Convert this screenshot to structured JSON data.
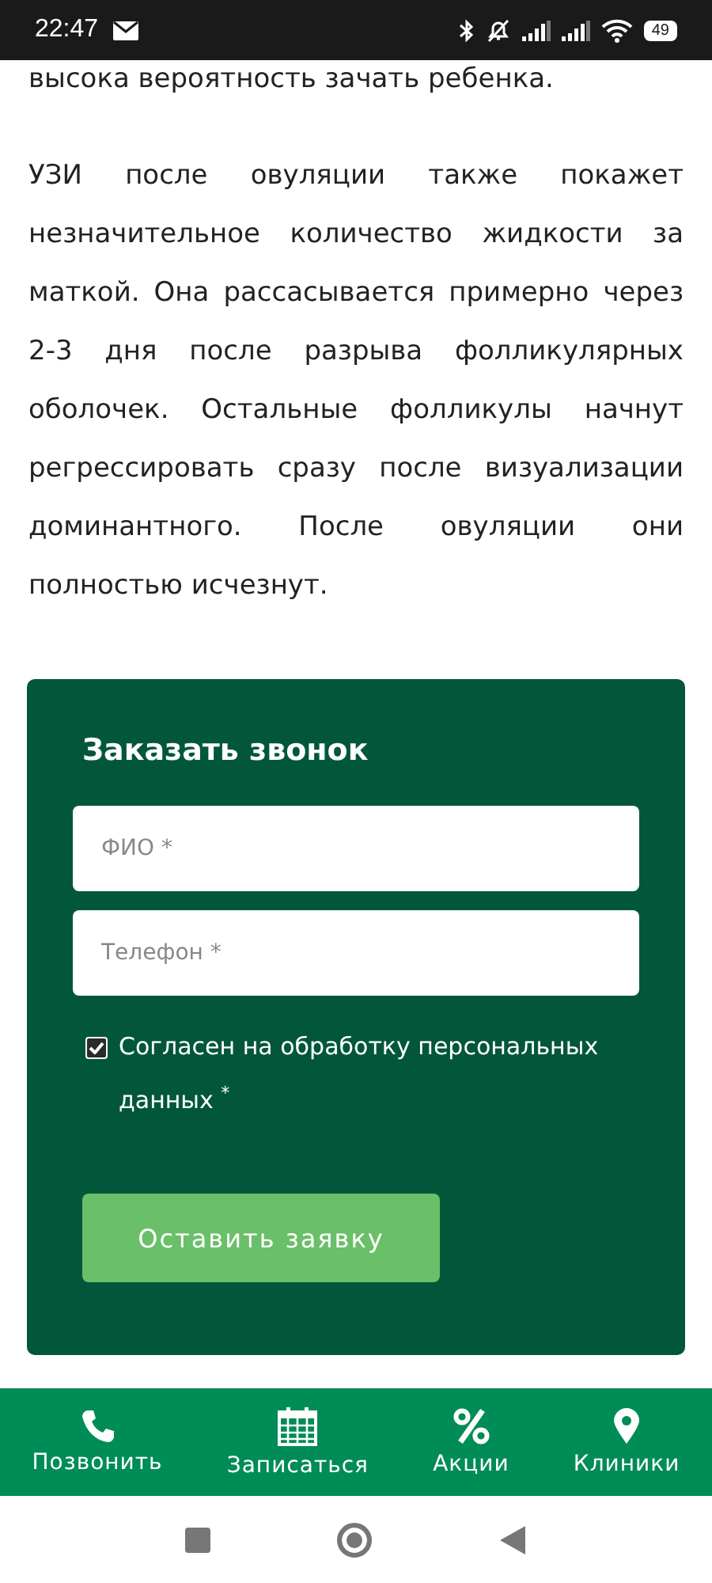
{
  "status_bar": {
    "time": "22:47",
    "battery": "49"
  },
  "article": {
    "paragraphs": [
      "высока вероятность зачать ребенка.",
      "УЗИ после овуляции также покажет незначительное количество жидкости за маткой. Она рассасывается примерно через 2-3 дня после разрыва фолликулярных оболочек. Остальные фолликулы начнут регрессировать сразу после визуализации доминантного. После овуляции они полностью исчезнут."
    ]
  },
  "callback_form": {
    "title": "Заказать звонок",
    "fields": [
      {
        "placeholder": "ФИО *"
      },
      {
        "placeholder": "Телефон *"
      }
    ],
    "consent": {
      "label": "Согласен на обработку персональных данных",
      "required_mark": "*",
      "checked": true
    },
    "submit": "Оставить заявку"
  },
  "bottom_nav": [
    {
      "kind": "phone",
      "label": "Позвонить"
    },
    {
      "kind": "calendar",
      "label": "Записаться"
    },
    {
      "kind": "percent",
      "label": "Акции"
    },
    {
      "kind": "pin",
      "label": "Клиники"
    }
  ]
}
